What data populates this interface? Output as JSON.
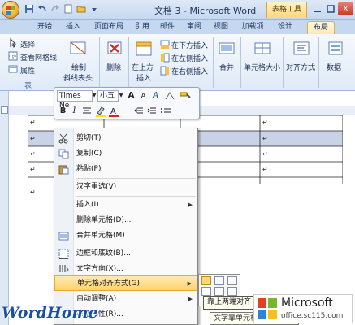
{
  "title_bar": {
    "title": "文档 3 - Microsoft Word",
    "context_tab": "表格工具",
    "close_glyph": "x"
  },
  "tabs": [
    "开始",
    "插入",
    "页面布局",
    "引用",
    "邮件",
    "审阅",
    "视图",
    "加载项",
    "设计",
    "布局"
  ],
  "ribbon": {
    "select": "选择",
    "view_gridlines": "查看网格线",
    "properties": "属性",
    "table_group": "表",
    "draw_diagonal": "绘制斜线表头",
    "delete": "删除",
    "insert_above": "在上方插入",
    "insert_below": "在下方插入",
    "insert_left": "在左侧插入",
    "insert_right": "在右侧插入",
    "merge": "合并",
    "cell_size": "单元格大小",
    "alignment": "对齐方式",
    "data": "数据"
  },
  "mini_toolbar": {
    "font_name": "Times Ne",
    "font_size": "小五",
    "bold": "B",
    "italic": "I",
    "grow_font": "A",
    "shrink_font": "A",
    "format_painter": "A"
  },
  "context_menu": {
    "items": [
      {
        "label": "剪切(T)",
        "icon": "scissors-icon",
        "submenu": false
      },
      {
        "label": "复制(C)",
        "icon": "copy-icon",
        "submenu": false
      },
      {
        "label": "粘贴(P)",
        "icon": "paste-icon",
        "submenu": false
      },
      {
        "label": "汉字重选(V)",
        "icon": "",
        "submenu": false
      },
      {
        "label": "插入(I)",
        "icon": "",
        "submenu": true
      },
      {
        "label": "删除单元格(D)...",
        "icon": "",
        "submenu": false
      },
      {
        "label": "合并单元格(M)",
        "icon": "merge-cells-icon",
        "submenu": false
      },
      {
        "label": "边框和底纹(B)...",
        "icon": "borders-icon",
        "submenu": false
      },
      {
        "label": "文字方向(X)...",
        "icon": "text-direction-icon",
        "submenu": false
      },
      {
        "label": "单元格对齐方式(G)",
        "icon": "",
        "submenu": true
      },
      {
        "label": "自动调整(A)",
        "icon": "",
        "submenu": true
      },
      {
        "label": "表格属性(R)...",
        "icon": "",
        "submenu": false
      }
    ],
    "highlighted_index": 9
  },
  "alignment_submenu": {
    "tooltip": "靠上两端对齐",
    "tooltip_desc": "文字靠单元格左上角对齐"
  },
  "branding": {
    "watermark": "WordHome",
    "ms_name": "Microsoft",
    "ms_site": "office.sc115.com"
  },
  "colors": {
    "accent_orange": "#ffd26d",
    "ribbon_blue": "#dfeaf7",
    "font_color_red": "#e02020",
    "highlight_yellow": "#ffe400"
  }
}
